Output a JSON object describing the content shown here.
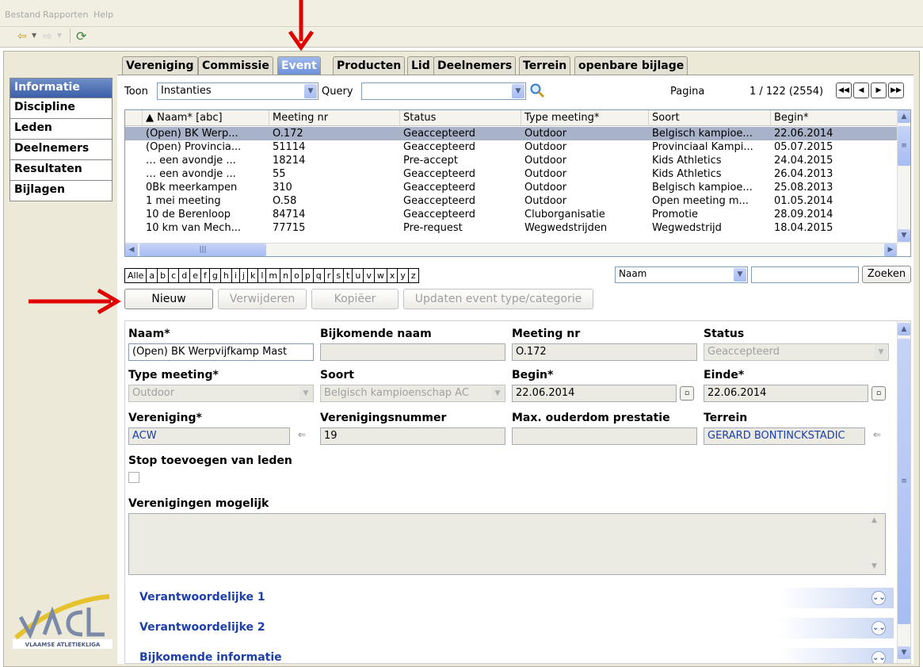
{
  "menu": [
    "Bestand",
    "Rapporten",
    "Help"
  ],
  "tabs": [
    "Vereniging",
    "Commissie",
    "Event",
    "Producten",
    "Lid",
    "Deelnemers",
    "Terrein",
    "openbare bijlage"
  ],
  "active_tab": "Event",
  "sidebar": [
    "Informatie",
    "Discipline",
    "Leden",
    "Deelnemers",
    "Resultaten",
    "Bijlagen"
  ],
  "filter": {
    "toon_label": "Toon",
    "toon_value": "Instanties",
    "query_label": "Query",
    "query_value": "",
    "pagina_label": "Pagina",
    "pagina_value": "1 / 122 (2554)"
  },
  "table": {
    "columns": [
      "▲ Naam* [abc]",
      "Meeting nr",
      "Status",
      "Type meeting*",
      "Soort",
      "Begin*"
    ],
    "rows": [
      [
        "(Open) BK Werp...",
        "O.172",
        "Geaccepteerd",
        "Outdoor",
        "Belgisch kampioe...",
        "22.06.2014"
      ],
      [
        "(Open) Provincia...",
        "51114",
        "Geaccepteerd",
        "Outdoor",
        "Provinciaal Kampi...",
        "05.07.2015"
      ],
      [
        "… een avondje ...",
        "18214",
        "Pre-accept",
        "Outdoor",
        "Kids Athletics",
        "24.04.2015"
      ],
      [
        "… een avondje ...",
        "55",
        "Geaccepteerd",
        "Outdoor",
        "Kids Athletics",
        "26.04.2013"
      ],
      [
        "0Bk meerkampen",
        "310",
        "Geaccepteerd",
        "Outdoor",
        "Belgisch kampioe...",
        "25.08.2013"
      ],
      [
        "1 mei meeting",
        "O.58",
        "Geaccepteerd",
        "Outdoor",
        "Open meeting m...",
        "01.05.2014"
      ],
      [
        "10 de Berenloop",
        "84714",
        "Geaccepteerd",
        "Cluborganisatie",
        "Promotie",
        "28.09.2014"
      ],
      [
        "10 km van Mech...",
        "77715",
        "Pre-request",
        "Wegwedstrijden",
        "Wegwedstrijd",
        "18.04.2015"
      ]
    ]
  },
  "alphabet": [
    "Alle",
    "a",
    "b",
    "c",
    "d",
    "e",
    "f",
    "g",
    "h",
    "i",
    "j",
    "k",
    "l",
    "m",
    "n",
    "o",
    "p",
    "q",
    "r",
    "s",
    "t",
    "u",
    "v",
    "w",
    "x",
    "y",
    "z"
  ],
  "search": {
    "field": "Naam",
    "value": "",
    "button": "Zoeken"
  },
  "actions": {
    "nieuw": "Nieuw",
    "verwijderen": "Verwijderen",
    "kopieer": "Kopiëer",
    "updaten": "Updaten event type/categorie"
  },
  "detail": {
    "naam_label": "Naam*",
    "naam_value": "(Open) BK Werpvijfkamp Mast",
    "bijkomende_naam_label": "Bijkomende naam",
    "bijkomende_naam_value": "",
    "meeting_nr_label": "Meeting nr",
    "meeting_nr_value": "O.172",
    "status_label": "Status",
    "status_value": "Geaccepteerd",
    "type_meeting_label": "Type meeting*",
    "type_meeting_value": "Outdoor",
    "soort_label": "Soort",
    "soort_value": "Belgisch kampioenschap AC",
    "begin_label": "Begin*",
    "begin_value": "22.06.2014",
    "einde_label": "Einde*",
    "einde_value": "22.06.2014",
    "vereniging_label": "Vereniging*",
    "vereniging_value": "ACW",
    "verenigingsnummer_label": "Verenigingsnummer",
    "verenigingsnummer_value": "19",
    "max_ouderdom_label": "Max. ouderdom prestatie",
    "max_ouderdom_value": "",
    "terrein_label": "Terrein",
    "terrein_value": "GERARD BONTINCKSTADIC",
    "stop_label": "Stop toevoegen van leden",
    "verenigingen_label": "Verenigingen mogelijk",
    "verenigingen_value": ""
  },
  "sections": [
    "Verantwoordelijke 1",
    "Verantwoordelijke 2",
    "Bijkomende informatie"
  ],
  "colors": {
    "accent": "#3b5fa8",
    "arrow": "#e00000",
    "section_text": "#1c3fa8",
    "selected_row": "#a8b2c8"
  }
}
